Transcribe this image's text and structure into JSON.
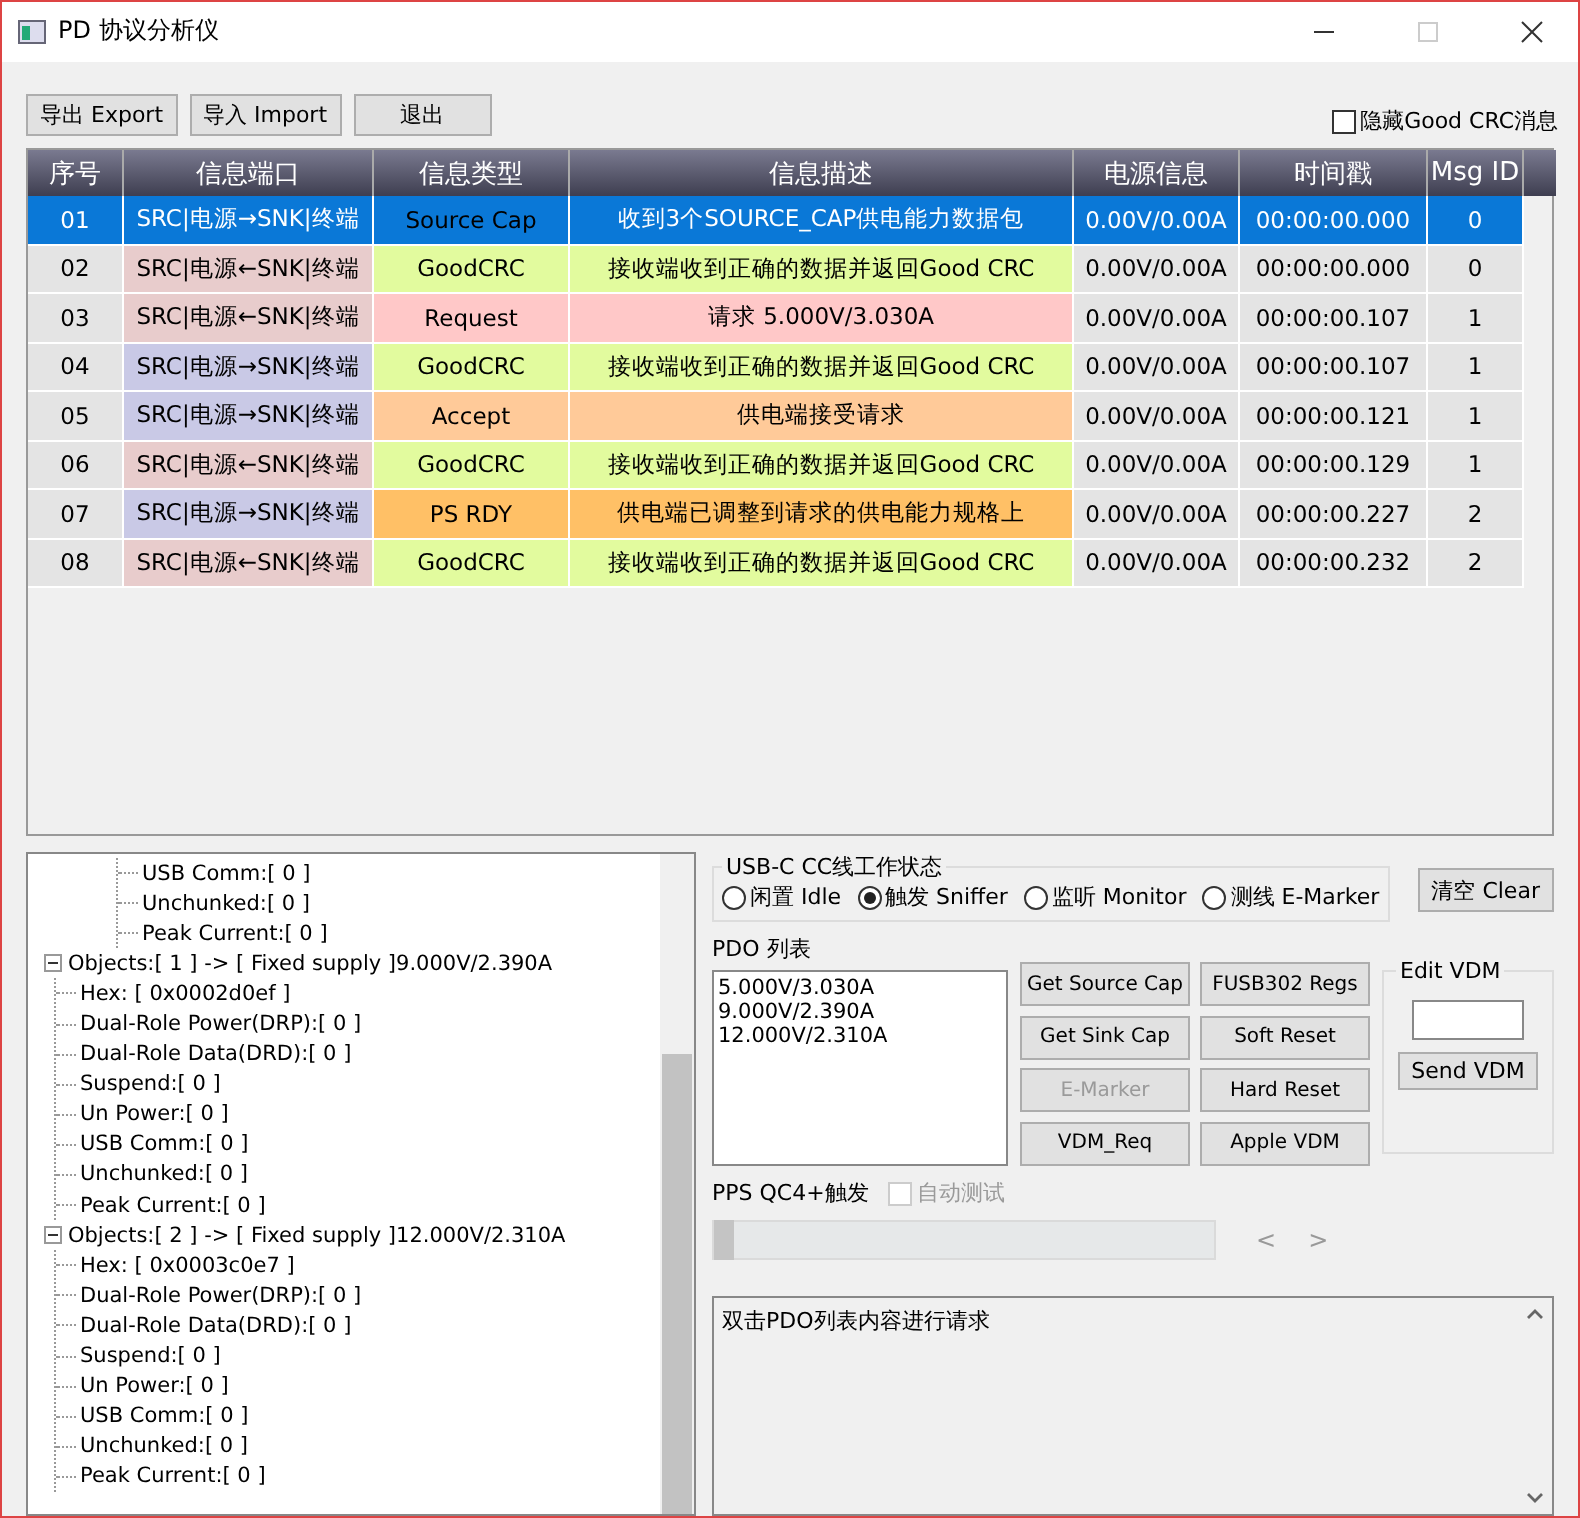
{
  "window": {
    "title": "PD 协议分析仪"
  },
  "toolbar": {
    "buttons": [
      "导出 Export",
      "导入 Import",
      "退出"
    ],
    "hide_goodcrc": {
      "label": "隐藏Good CRC消息",
      "checked": false
    }
  },
  "table": {
    "columns": [
      "序号",
      "信息端口",
      "信息类型",
      "信息描述",
      "电源信息",
      "时间戳",
      "Msg  ID"
    ],
    "rows": [
      {
        "selected": true,
        "cells": [
          {
            "text": "01"
          },
          {
            "text": "SRC|电源→SNK|终端"
          },
          {
            "text": "Source Cap"
          },
          {
            "text": "收到3个SOURCE_CAP供电能力数据包"
          },
          {
            "text": "0.00V/0.00A"
          },
          {
            "text": "00:00:00.000"
          },
          {
            "text": "0"
          }
        ]
      },
      {
        "selected": false,
        "cells": [
          {
            "text": "02"
          },
          {
            "text": "SRC|电源←SNK|终端",
            "color": "#e8cccc"
          },
          {
            "text": "GoodCRC",
            "color": "#e2fb9e"
          },
          {
            "text": "接收端收到正确的数据并返回Good CRC",
            "color": "#e2fb9e"
          },
          {
            "text": "0.00V/0.00A"
          },
          {
            "text": "00:00:00.000"
          },
          {
            "text": "0"
          }
        ]
      },
      {
        "selected": false,
        "cells": [
          {
            "text": "03"
          },
          {
            "text": "SRC|电源←SNK|终端",
            "color": "#e8cccc"
          },
          {
            "text": "Request",
            "color": "#ffc8c8"
          },
          {
            "text": "请求 5.000V/3.030A",
            "color": "#ffc8c8"
          },
          {
            "text": "0.00V/0.00A"
          },
          {
            "text": "00:00:00.107"
          },
          {
            "text": "1"
          }
        ]
      },
      {
        "selected": false,
        "cells": [
          {
            "text": "04"
          },
          {
            "text": "SRC|电源→SNK|终端",
            "color": "#c9c9e6"
          },
          {
            "text": "GoodCRC",
            "color": "#e2fb9e"
          },
          {
            "text": "接收端收到正确的数据并返回Good CRC",
            "color": "#e2fb9e"
          },
          {
            "text": "0.00V/0.00A"
          },
          {
            "text": "00:00:00.107"
          },
          {
            "text": "1"
          }
        ]
      },
      {
        "selected": false,
        "cells": [
          {
            "text": "05"
          },
          {
            "text": "SRC|电源→SNK|终端",
            "color": "#c9c9e6"
          },
          {
            "text": "Accept",
            "color": "#ffca99"
          },
          {
            "text": "供电端接受请求",
            "color": "#ffca99"
          },
          {
            "text": "0.00V/0.00A"
          },
          {
            "text": "00:00:00.121"
          },
          {
            "text": "1"
          }
        ]
      },
      {
        "selected": false,
        "cells": [
          {
            "text": "06"
          },
          {
            "text": "SRC|电源←SNK|终端",
            "color": "#e8cccc"
          },
          {
            "text": "GoodCRC",
            "color": "#e2fb9e"
          },
          {
            "text": "接收端收到正确的数据并返回Good CRC",
            "color": "#e2fb9e"
          },
          {
            "text": "0.00V/0.00A"
          },
          {
            "text": "00:00:00.129"
          },
          {
            "text": "1"
          }
        ]
      },
      {
        "selected": false,
        "cells": [
          {
            "text": "07"
          },
          {
            "text": "SRC|电源→SNK|终端",
            "color": "#c9c9e6"
          },
          {
            "text": "PS RDY",
            "color": "#ffc066"
          },
          {
            "text": "供电端已调整到请求的供电能力规格上",
            "color": "#ffc066"
          },
          {
            "text": "0.00V/0.00A"
          },
          {
            "text": "00:00:00.227"
          },
          {
            "text": "2"
          }
        ]
      },
      {
        "selected": false,
        "cells": [
          {
            "text": "08"
          },
          {
            "text": "SRC|电源←SNK|终端",
            "color": "#e8cccc"
          },
          {
            "text": "GoodCRC",
            "color": "#e2fb9e"
          },
          {
            "text": "接收端收到正确的数据并返回Good CRC",
            "color": "#e2fb9e"
          },
          {
            "text": "0.00V/0.00A"
          },
          {
            "text": "00:00:00.232"
          },
          {
            "text": "2"
          }
        ]
      }
    ]
  },
  "tree": {
    "items": [
      {
        "expanded": true,
        "children": [
          {
            "label": "USB Comm:[ 0 ]"
          },
          {
            "label": "Unchunked:[ 0 ]"
          },
          {
            "label": "Peak Current:[  0 ]"
          }
        ]
      },
      {
        "label": "Objects:[ 1 ] -> [ Fixed supply ]9.000V/2.390A",
        "expanded": true,
        "children": [
          {
            "label": "Hex: [ 0x0002d0ef ]"
          },
          {
            "label": "Dual-Role Power(DRP):[ 0 ]"
          },
          {
            "label": "Dual-Role Data(DRD):[ 0 ]"
          },
          {
            "label": "Suspend:[ 0 ]"
          },
          {
            "label": "Un Power:[ 0 ]"
          },
          {
            "label": "USB Comm:[ 0 ]"
          },
          {
            "label": "Unchunked:[ 0 ]"
          },
          {
            "label": "Peak Current:[  0 ]"
          }
        ]
      },
      {
        "label": "Objects:[ 2 ] -> [ Fixed supply ]12.000V/2.310A",
        "expanded": true,
        "children": [
          {
            "label": "Hex: [ 0x0003c0e7 ]"
          },
          {
            "label": "Dual-Role Power(DRP):[ 0 ]"
          },
          {
            "label": "Dual-Role Data(DRD):[ 0 ]"
          },
          {
            "label": "Suspend:[ 0 ]"
          },
          {
            "label": "Un Power:[ 0 ]"
          },
          {
            "label": "USB Comm:[ 0 ]"
          },
          {
            "label": "Unchunked:[ 0 ]"
          },
          {
            "label": "Peak Current:[  0 ]"
          }
        ]
      }
    ]
  },
  "cc_state": {
    "title": "USB-C CC线工作状态",
    "options": [
      {
        "label": "闲置 Idle",
        "selected": false
      },
      {
        "label": "触发 Sniffer",
        "selected": true
      },
      {
        "label": "监听 Monitor",
        "selected": false
      },
      {
        "label": "测线 E-Marker",
        "selected": false
      }
    ]
  },
  "clear_button": "清空 Clear",
  "pdo": {
    "title": "PDO 列表",
    "items": [
      "5.000V/3.030A",
      "9.000V/2.390A",
      "12.000V/2.310A"
    ]
  },
  "actions": [
    {
      "label": "Get Source Cap",
      "disabled": false
    },
    {
      "label": "FUSB302 Regs",
      "disabled": false
    },
    {
      "label": "Get Sink Cap",
      "disabled": false
    },
    {
      "label": "Soft Reset",
      "disabled": false
    },
    {
      "label": "E-Marker",
      "disabled": true
    },
    {
      "label": "Hard Reset",
      "disabled": false
    },
    {
      "label": "VDM_Req",
      "disabled": false
    },
    {
      "label": "Apple VDM",
      "disabled": false
    }
  ],
  "edit_vdm": {
    "title": "Edit VDM",
    "button": "Send VDM"
  },
  "pps": {
    "label": "PPS QC4+触发",
    "auto_test": {
      "label": "自动测试",
      "checked": false,
      "disabled": true
    },
    "slider": {
      "level": 0
    },
    "prev": "<",
    "next": ">"
  },
  "log": {
    "text": "双击PDO列表内容进行请求"
  }
}
